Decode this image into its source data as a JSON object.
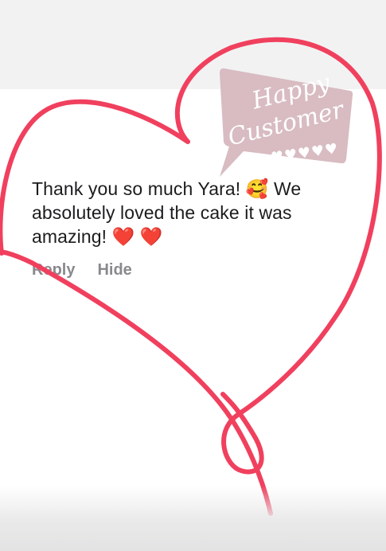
{
  "comment": {
    "text": "Thank you so much Yara! 🥰 We absolutely loved the cake it was amazing! ❤️ ❤️",
    "actions": {
      "reply": "Reply",
      "hide": "Hide"
    }
  },
  "sticker": {
    "line1": "Happy",
    "line2": "Customer",
    "hearts": "♥♥♥♥♥"
  },
  "colors": {
    "heart_stroke": "#f0405e",
    "sticker_fill": "#d8bcc2",
    "action_text": "#8a8a8e",
    "comment_text": "#1c1c1e"
  }
}
